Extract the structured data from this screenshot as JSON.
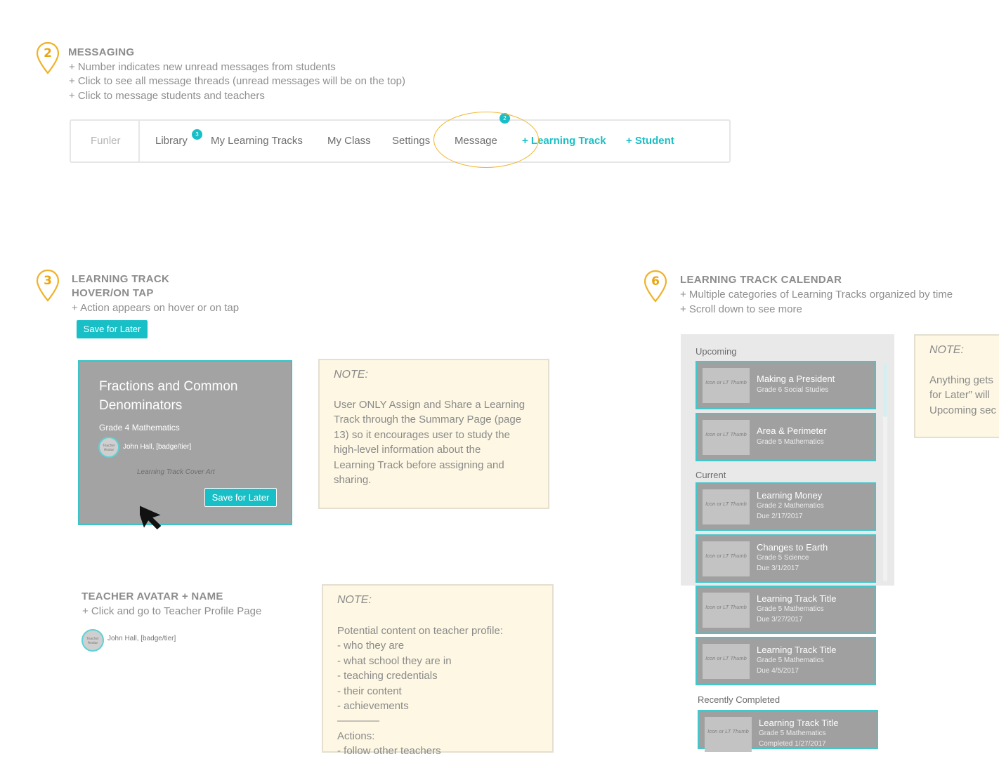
{
  "section_messaging": {
    "number": "2",
    "title": "MESSAGING",
    "lines": [
      "+ Number indicates new unread messages from students",
      "+ Click to see all message threads (unread messages will be on the top)",
      "+ Click to message students and teachers"
    ]
  },
  "nav": {
    "brand": "Funler",
    "library": "Library",
    "library_badge": "3",
    "my_learning_tracks": "My Learning Tracks",
    "my_class": "My Class",
    "settings": "Settings",
    "message": "Message",
    "message_badge": "2",
    "add_learning_track": "+ Learning Track",
    "add_student": "+ Student"
  },
  "section_hover": {
    "number": "3",
    "title_line1": "LEARNING TRACK",
    "title_line2": "HOVER/ON TAP",
    "line": "+ Action appears on hover or on tap",
    "save_button": "Save for Later"
  },
  "card": {
    "title": "Fractions and Common Denominators",
    "grade": "Grade 4 Mathematics",
    "avatar_text": "Teacher Avatar",
    "author": "John Hall, [badge/tier]",
    "cover_art": "Learning Track Cover Art",
    "save_button": "Save for Later"
  },
  "note1": {
    "heading": "NOTE:",
    "body": "User ONLY Assign and Share a Learning\nTrack through the Summary Page (page\n13) so it encourages user to study the\nhigh-level information about the\nLearning Track before assigning and\nsharing."
  },
  "section_teacher": {
    "title": "TEACHER AVATAR + NAME",
    "line": "+ Click and go to Teacher Profile Page",
    "avatar_text": "Teacher Avatar",
    "name": "John Hall, [badge/tier]"
  },
  "note2": {
    "heading": "NOTE:",
    "body": "Potential content on teacher profile:\n- who they are\n- what school they are in\n- teaching credentials\n- their content\n- achievements\n————\nActions:\n- follow other teachers"
  },
  "section_calendar": {
    "number": "6",
    "title": "LEARNING TRACK CALENDAR",
    "lines": [
      "+ Multiple categories of Learning Tracks organized by time",
      "+ Scroll down to see more"
    ]
  },
  "calendar": {
    "thumb_text": "Icon or LT Thumb",
    "upcoming_label": "Upcoming",
    "current_label": "Current",
    "completed_label": "Recently Completed",
    "upcoming": [
      {
        "title": "Making a President",
        "grade": "Grade 6 Social Studies"
      },
      {
        "title": "Area & Perimeter",
        "grade": "Grade 5 Mathematics"
      }
    ],
    "current": [
      {
        "title": "Learning Money",
        "grade": "Grade 2 Mathematics",
        "due": "Due 2/17/2017"
      },
      {
        "title": "Changes to Earth",
        "grade": "Grade 5 Science",
        "due": "Due 3/1/2017"
      },
      {
        "title": "Learning Track Title",
        "grade": "Grade 5 Mathematics",
        "due": "Due 3/27/2017"
      },
      {
        "title": "Learning Track Title",
        "grade": "Grade 5 Mathematics",
        "due": "Due 4/5/2017"
      }
    ],
    "completed": [
      {
        "title": "Learning Track Title",
        "grade": "Grade 5 Mathematics",
        "due": "Completed 1/27/2017"
      }
    ]
  },
  "note3": {
    "heading": "NOTE:",
    "lines": [
      "Anything gets",
      "for Later” will",
      "Upcoming sec"
    ]
  },
  "colors": {
    "accent": "#19bfc6",
    "pin": "#e8a514",
    "card_gray": "#a3a3a3",
    "note_bg": "#fdf7e3"
  }
}
